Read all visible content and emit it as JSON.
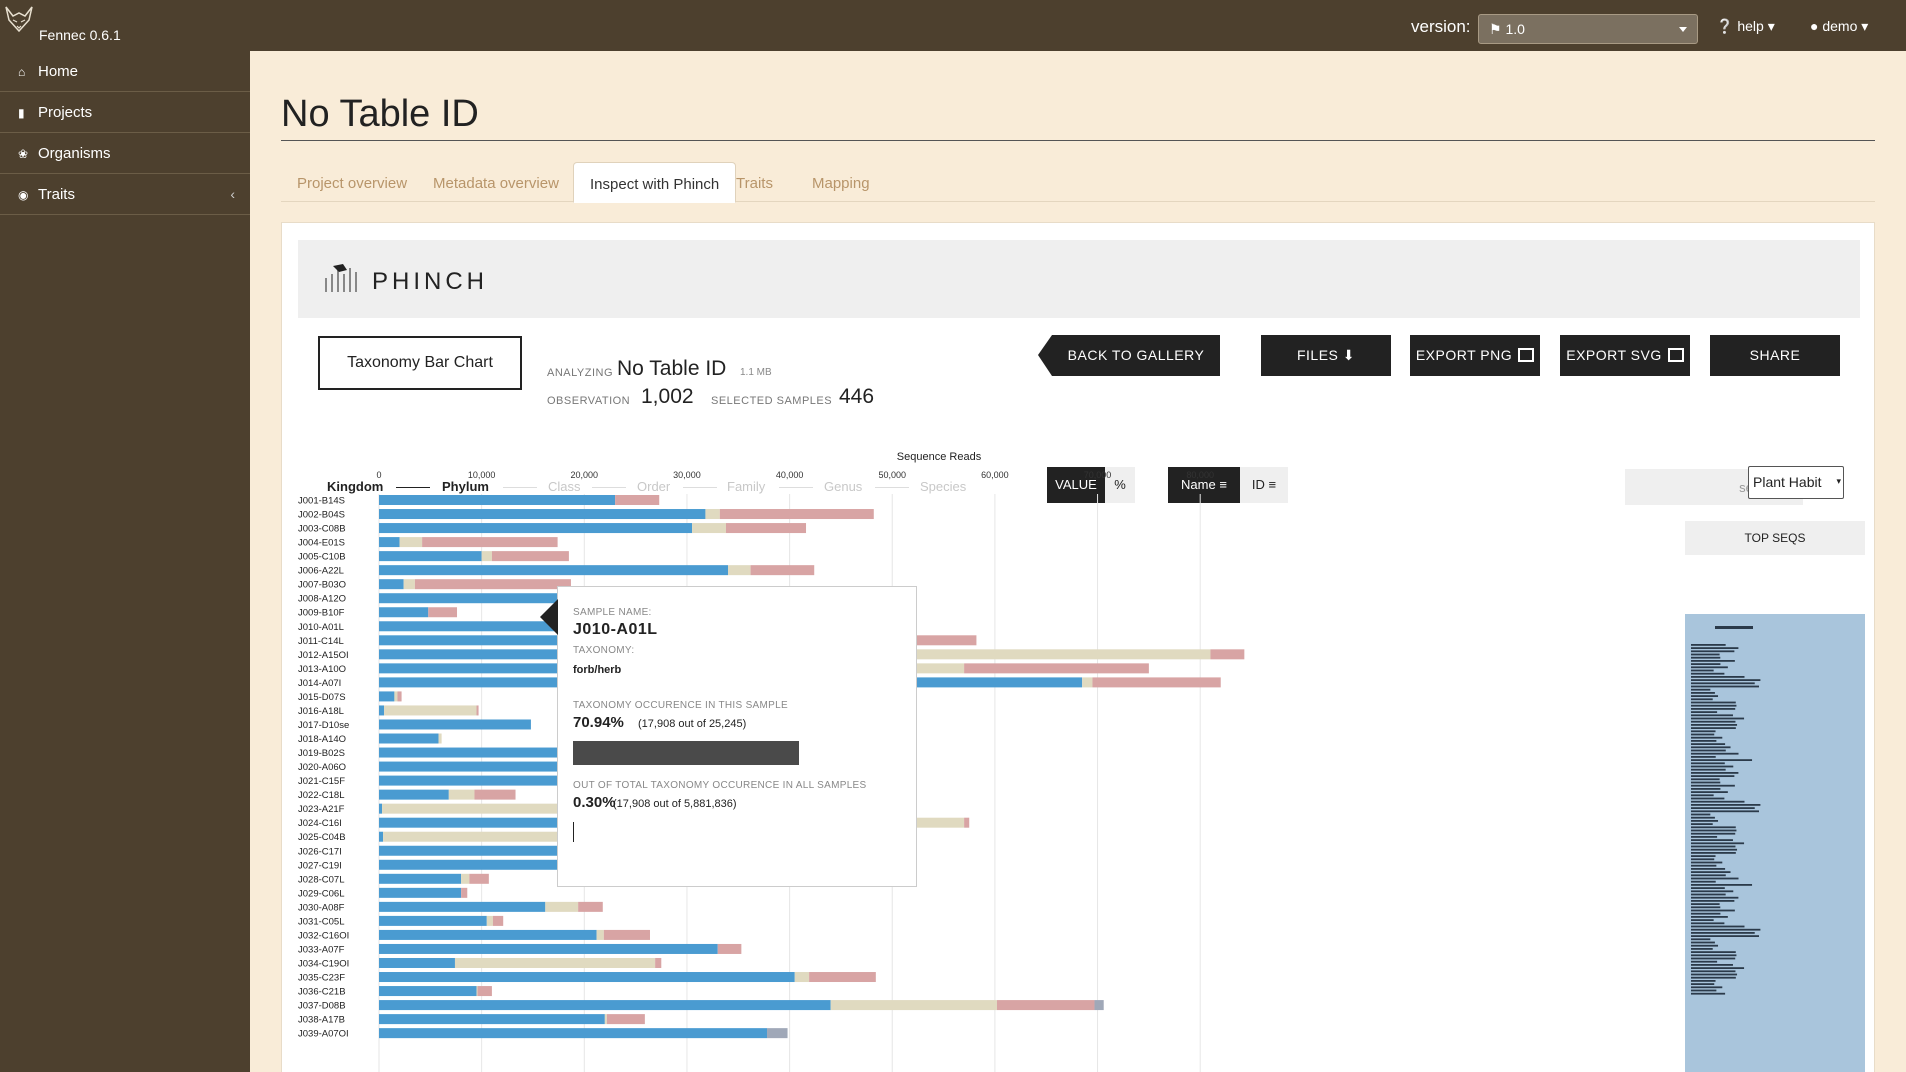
{
  "app": {
    "name": "Fennec 0.6.1",
    "version_label": "version:",
    "version_value": "1.0",
    "help": "help",
    "user": "demo"
  },
  "sidebar": {
    "items": [
      {
        "label": "Home",
        "icon": "home-icon"
      },
      {
        "label": "Projects",
        "icon": "book-icon"
      },
      {
        "label": "Organisms",
        "icon": "leaf-icon"
      },
      {
        "label": "Traits",
        "icon": "globe-icon"
      }
    ]
  },
  "page": {
    "title": "No Table ID"
  },
  "tabs": [
    "Project overview",
    "Metadata overview",
    "Inspect with Phinch",
    "Traits",
    "Mapping"
  ],
  "phinch": {
    "logo_text": "PHINCH",
    "viz_button": "Taxonomy Bar Chart",
    "analyzing_label": "ANALYZING",
    "analyzing_value": "No Table ID",
    "file_size": "1.1 MB",
    "observation_label": "OBSERVATION",
    "observation_value": "1,002",
    "selected_label": "SELECTED SAMPLES",
    "selected_value": "446",
    "buttons": {
      "back": "BACK TO GALLERY",
      "files": "FILES",
      "png": "EXPORT PNG",
      "svg": "EXPORT SVG",
      "share": "SHARE"
    },
    "levels": [
      "Kingdom",
      "Phylum",
      "Class",
      "Order",
      "Family",
      "Genus",
      "Species"
    ],
    "value_toggle": [
      "VALUE",
      "%"
    ],
    "sort_toggle": [
      "Name",
      "ID"
    ],
    "search_placeholder": "search...",
    "attribute_select": "Plant Habit",
    "top_seqs": "TOP SEQS"
  },
  "colors": {
    "series1": "#4a9bd1",
    "series2": "#e0dac0",
    "series3": "#d8a4a4",
    "series4": "#a0a8b8"
  },
  "tooltip": {
    "sample_label": "SAMPLE NAME:",
    "sample_value": "J010-A01L",
    "taxonomy_label": "TAXONOMY:",
    "taxonomy_value": "forb/herb",
    "occ_label": "TAXONOMY OCCURENCE IN THIS SAMPLE",
    "occ_pct": "70.94%",
    "occ_detail": "(17,908 out of 25,245)",
    "occ_fraction": 0.7094,
    "total_label": "OUT OF TOTAL TAXONOMY OCCURENCE IN ALL SAMPLES",
    "total_pct": "0.30%",
    "total_detail": "(17,908 out of 5,881,836)",
    "total_fraction": 0.003
  },
  "chart_data": {
    "type": "bar",
    "title": "Sequence Reads",
    "orientation": "horizontal",
    "stacked": true,
    "xlim": [
      0,
      82000
    ],
    "x_ticks": [
      0,
      10000,
      20000,
      30000,
      40000,
      50000,
      60000,
      70000,
      80000
    ],
    "x_tick_labels": [
      "0",
      "10,000",
      "20,000",
      "30,000",
      "40,000",
      "50,000",
      "60,000",
      "70,000",
      "80,000"
    ],
    "grid": true,
    "categories": [
      "J001-B14S",
      "J002-B04S",
      "J003-C08B",
      "J004-E01S",
      "J005-C10B",
      "J006-A22L",
      "J007-B03O",
      "J008-A12O",
      "J009-B10F",
      "J010-A01L",
      "J011-C14L",
      "J012-A15OI",
      "J013-A10O",
      "J014-A07I",
      "J015-D07S",
      "J016-A18L",
      "J017-D10se",
      "J018-A14O",
      "J019-B02S",
      "J020-A06O",
      "J021-C15F",
      "J022-C18L",
      "J023-A21F",
      "J024-C16I",
      "J025-C04B",
      "J026-C17I",
      "J027-C19I",
      "J028-C07L",
      "J029-C06L",
      "J030-A08F",
      "J031-C05L",
      "J032-C16OI",
      "J033-A07F",
      "J034-C19OI",
      "J035-C23F",
      "J036-C21B",
      "J037-D08B",
      "J038-A17B",
      "J039-A07OI"
    ],
    "series": [
      {
        "values": [
          23000,
          31800,
          30500,
          2000,
          10000,
          34000,
          2400,
          29400,
          4800,
          17908,
          48200,
          46000,
          45000,
          68500,
          1500,
          500,
          14800,
          5800,
          43000,
          45000,
          43000,
          6800,
          300,
          45000,
          400,
          46000,
          44000,
          8000,
          8000,
          16200,
          10500,
          21200,
          33000,
          7400,
          40500,
          9500,
          44000,
          22000,
          37800
        ]
      },
      {
        "values": [
          0,
          1400,
          3300,
          2200,
          1000,
          2200,
          1100,
          0,
          0,
          4900,
          0,
          35000,
          12000,
          1000,
          300,
          9000,
          0,
          300,
          0,
          0,
          0,
          2500,
          39000,
          12000,
          43000,
          0,
          0,
          800,
          0,
          3200,
          600,
          700,
          0,
          19500,
          1400,
          100,
          16200,
          200,
          0
        ]
      },
      {
        "values": [
          4300,
          15000,
          7800,
          13200,
          7500,
          6200,
          15200,
          1500,
          2800,
          2437,
          10000,
          3300,
          18000,
          12500,
          400,
          200,
          0,
          0,
          900,
          0,
          0,
          4000,
          0,
          500,
          0,
          0,
          0,
          1900,
          600,
          2400,
          1000,
          4500,
          2300,
          600,
          6500,
          1400,
          9500,
          3700,
          0
        ]
      },
      {
        "values": [
          0,
          0,
          0,
          0,
          0,
          0,
          0,
          0,
          0,
          0,
          0,
          0,
          0,
          0,
          0,
          0,
          0,
          0,
          0,
          0,
          0,
          0,
          0,
          0,
          0,
          0,
          0,
          0,
          0,
          0,
          0,
          0,
          0,
          0,
          0,
          0,
          900,
          0,
          2000
        ]
      }
    ]
  }
}
